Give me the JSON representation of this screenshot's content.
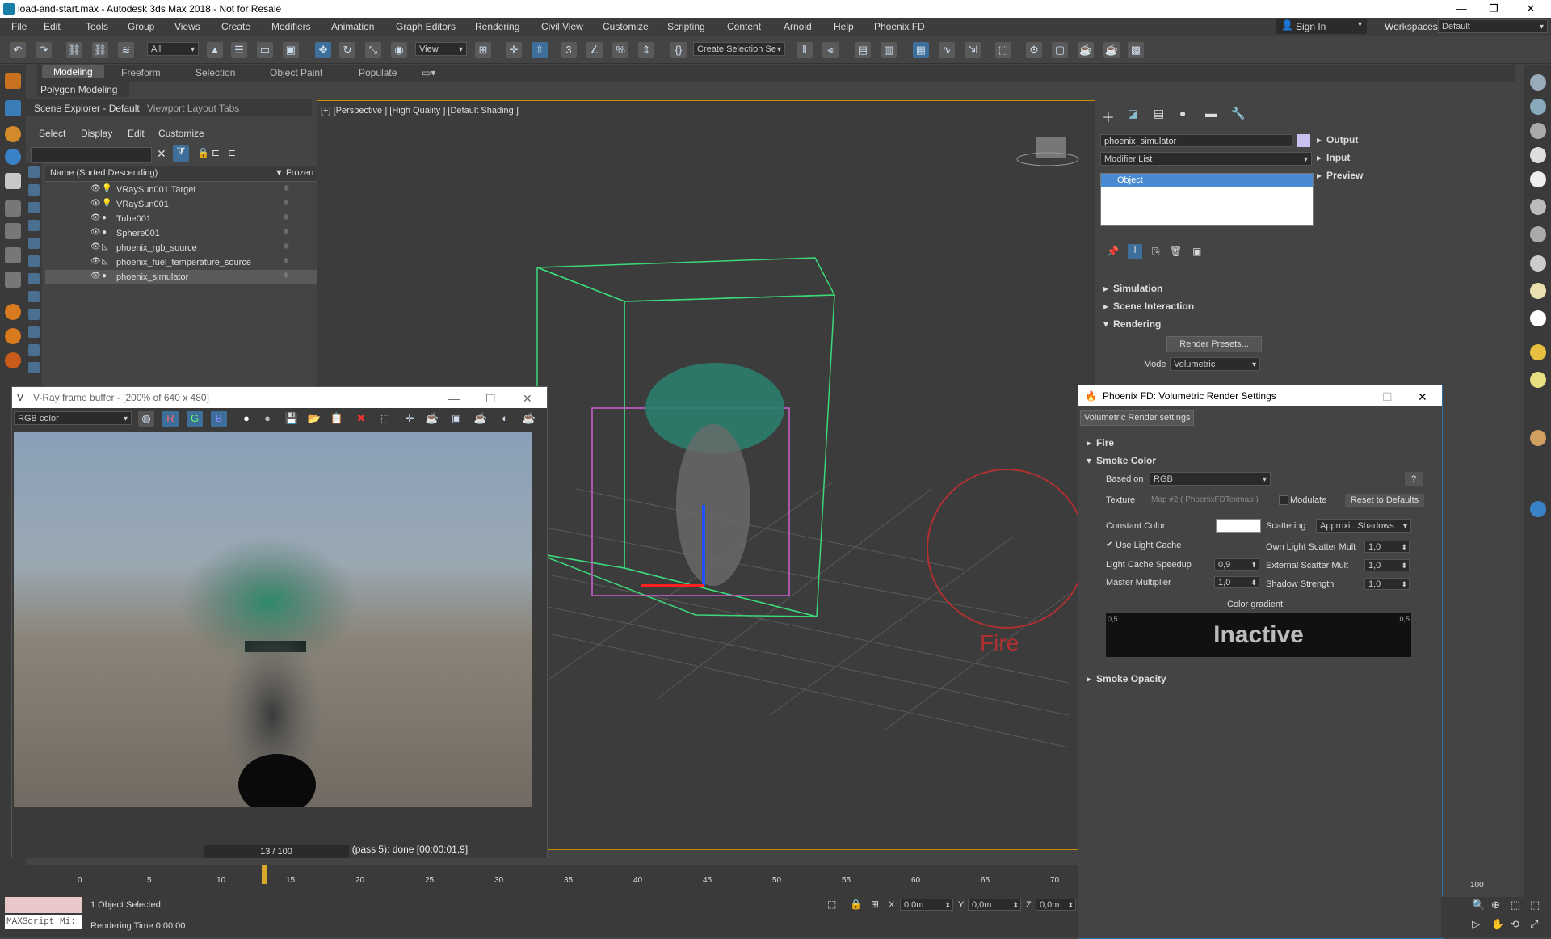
{
  "window": {
    "title": "load-and-start.max - Autodesk 3ds Max 2018 - Not for Resale",
    "min": "—",
    "max": "❐",
    "close": "✕"
  },
  "menu": [
    "File",
    "Edit",
    "Tools",
    "Group",
    "Views",
    "Create",
    "Modifiers",
    "Animation",
    "Graph Editors",
    "Rendering",
    "Civil View",
    "Customize",
    "Scripting",
    "Content",
    "Arnold",
    "Help",
    "Phoenix FD"
  ],
  "account": {
    "sign_in": "Sign In",
    "workspaces_label": "Workspaces:",
    "workspace": "Default"
  },
  "toolbar": {
    "filter": "All",
    "view": "View",
    "selection_set": "Create Selection Se"
  },
  "ribbon": {
    "tabs": [
      "Modeling",
      "Freeform",
      "Selection",
      "Object Paint",
      "Populate"
    ],
    "sub": "Polygon Modeling"
  },
  "scene_explorer": {
    "title": "Scene Explorer - Default",
    "layout_tabs": "Viewport Layout Tabs",
    "menu": [
      "Select",
      "Display",
      "Edit",
      "Customize"
    ],
    "col_name": "Name (Sorted Descending)",
    "col_frozen": "Frozen",
    "rows": [
      "VRaySun001.Target",
      "VRaySun001",
      "Tube001",
      "Sphere001",
      "phoenix_rgb_source",
      "phoenix_fuel_temperature_source",
      "phoenix_simulator"
    ]
  },
  "viewport": {
    "label": "[+] [Perspective ] [High Quality ] [Default Shading ]",
    "fire_label": "Fire"
  },
  "vfb": {
    "title": "V-Ray frame buffer - [200% of 640 x 480]",
    "channel": "RGB color",
    "status": "Rendering image (pass 5): done [00:00:01,9]"
  },
  "command_panel": {
    "object_name": "phoenix_simulator",
    "modifier_list": "Modifier List",
    "stack_item": "Object",
    "rollouts_right": [
      "Output",
      "Input",
      "Preview"
    ],
    "rollouts": [
      "Simulation",
      "Scene Interaction",
      "Rendering"
    ],
    "render_presets": "Render Presets...",
    "mode_label": "Mode",
    "mode_value": "Volumetric"
  },
  "pfd": {
    "title": "Phoenix FD: Volumetric Render Settings",
    "tab": "Volumetric Render settings",
    "fire": "Fire",
    "smoke_color": "Smoke Color",
    "based_on_label": "Based on",
    "based_on": "RGB",
    "help": "?",
    "texture_label": "Texture",
    "texture_value": "Map #2 ( PhoenixFDTexmap )",
    "modulate": "Modulate",
    "reset": "Reset to Defaults",
    "constant_color": "Constant Color",
    "scattering_label": "Scattering",
    "scattering_value": "Approxi...Shadows",
    "use_light_cache": "Use Light Cache",
    "own_light": "Own Light Scatter Mult",
    "own_light_val": "1,0",
    "lc_speedup": "Light Cache Speedup",
    "lc_speedup_val": "0,9",
    "ext_light": "External Scatter Mult",
    "ext_light_val": "1,0",
    "master": "Master Multiplier",
    "master_val": "1,0",
    "shadow": "Shadow Strength",
    "shadow_val": "1,0",
    "gradient_label": "Color gradient",
    "grad_min": "0,5",
    "grad_max": "0,5",
    "inactive": "Inactive",
    "smoke_opacity": "Smoke Opacity"
  },
  "timeline": {
    "frame": "13 / 100",
    "ticks": [
      "0",
      "5",
      "10",
      "15",
      "20",
      "25",
      "30",
      "35",
      "40",
      "45",
      "50",
      "55",
      "60",
      "65",
      "70",
      "100"
    ]
  },
  "status": {
    "selected": "1 Object Selected",
    "render_time": "Rendering Time 0:00:00",
    "maxscript": "MAXScript Mi:",
    "x_label": "X:",
    "x": "0,0m",
    "y_label": "Y:",
    "y": "0,0m",
    "z_label": "Z:",
    "z": "0,0m"
  }
}
